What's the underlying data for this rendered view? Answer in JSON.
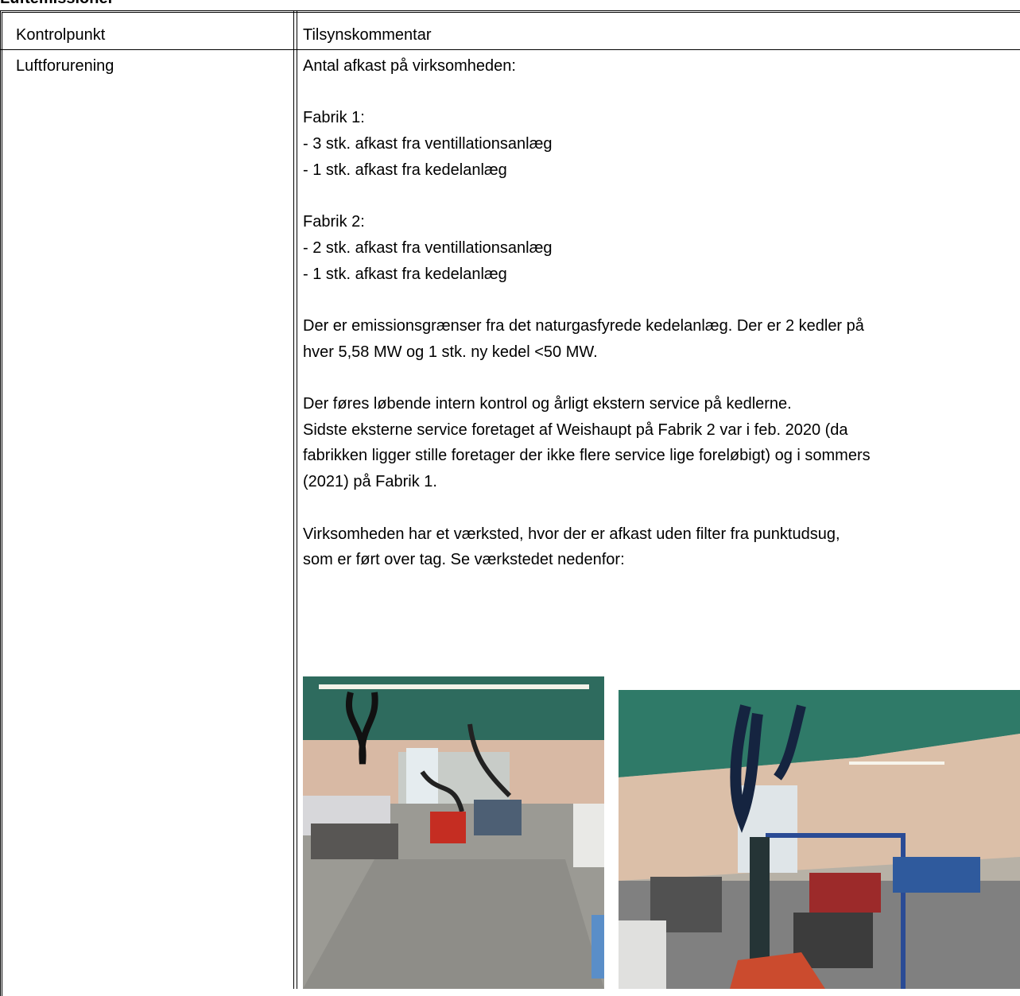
{
  "section": {
    "title": "Luftemissioner"
  },
  "table": {
    "headers": [
      "Kontrolpunkt",
      "Tilsynskommentar"
    ],
    "row": {
      "kontrolpunkt": "Luftforurening",
      "lines": [
        "Antal afkast på virksomheden:",
        "",
        "Fabrik 1:",
        "- 3 stk. afkast fra ventillationsanlæg",
        "- 1 stk. afkast fra kedelanlæg",
        "",
        "Fabrik 2:",
        "- 2 stk. afkast fra ventillationsanlæg",
        "- 1 stk. afkast fra kedelanlæg",
        "",
        "Der er emissionsgrænser fra det naturgasfyrede kedelanlæg. Der er 2 kedler på",
        "hver 5,58 MW og 1 stk. ny kedel <50 MW.",
        "",
        "Der føres løbende intern kontrol og årligt ekstern service på kedlerne.",
        "Sidste eksterne service foretaget af Weishaupt på Fabrik 2 var i feb. 2020 (da",
        "fabrikken ligger stille foretager der ikke flere service lige foreløbigt) og i sommers",
        "(2021) på Fabrik 1.",
        "",
        "Virksomheden har et værksted, hvor der er afkast uden filter fra punktudsug,",
        "som er ført over tag. Se værkstedet nedenfor:"
      ]
    }
  }
}
